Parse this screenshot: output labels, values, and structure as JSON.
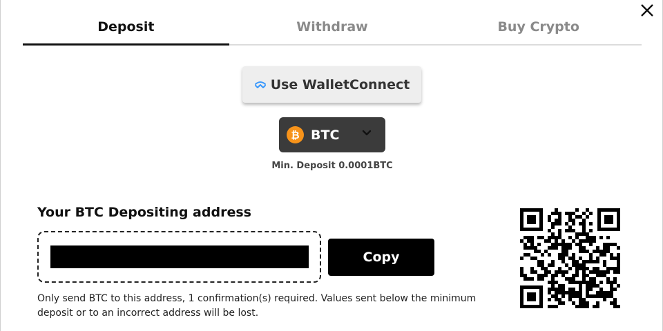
{
  "tabs": [
    {
      "label": "Deposit",
      "active": true
    },
    {
      "label": "Withdraw",
      "active": false
    },
    {
      "label": "Buy Crypto",
      "active": false
    }
  ],
  "walletconnect": {
    "label": "Use WalletConnect",
    "icon": "walletconnect-icon",
    "icon_color": "#3b99fc"
  },
  "coin_select": {
    "symbol_glyph": "₿",
    "label": "BTC",
    "icon": "bitcoin-icon",
    "icon_color": "#f7931a"
  },
  "min_deposit": "Min. Deposit 0.0001BTC",
  "address": {
    "title": "Your BTC Depositing address",
    "value": "",
    "copy_label": "Copy"
  },
  "note": "Only send BTC to this address, 1 confirmation(s) required. Values sent below the minimum deposit or to an incorrect address will be lost.",
  "colors": {
    "text": "#111111",
    "tab_inactive": "#8a8a8a",
    "dark_select": "#3b3b3b",
    "button_black": "#000000"
  }
}
